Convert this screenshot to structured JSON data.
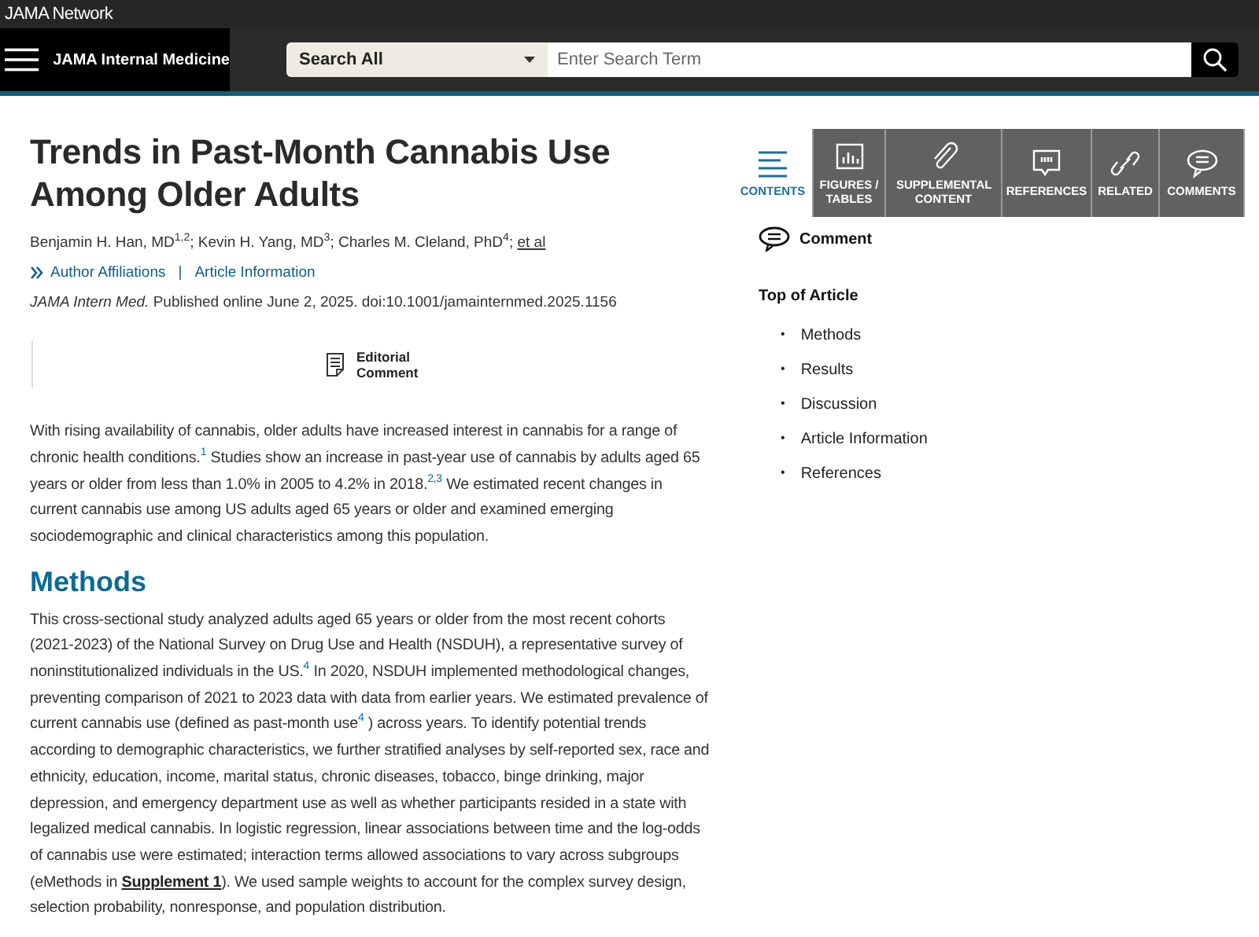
{
  "header": {
    "network": "JAMA Network",
    "journal": "JAMA Internal Medicine",
    "search_scope": "Search All",
    "search_placeholder": "Enter Search Term"
  },
  "article": {
    "title": "Trends in Past-Month Cannabis Use Among Older Adults",
    "authors": [
      {
        "text": "Benjamin H. Han, MD$^{1,2}$; Kevin H. Yang, MD$^{3}$; Charles M. Cleland, PhD$^{4}$; "
      },
      {
        "text": "et al",
        "kind": "link"
      }
    ],
    "info_links": [
      "Author Affiliations",
      "Article Information"
    ],
    "separator": "|",
    "citation": "*JAMA Intern Med.* Published online June 2, 2025. doi:10.1001/jamainternmed.2025.1156",
    "editorial": "Editorial Comment",
    "body": [
      {
        "kind": "paragraph",
        "segments": [
          {
            "text": "With rising availability of cannabis, older adults have increased interest in cannabis for a range of chronic health conditions.$^{1}$ Studies show an increase in past-year use of cannabis by adults aged 65 years or older from less than 1.0% in 2005 to 4.2% in 2018.$^{2,3}$ We estimated recent changes in current cannabis use among US adults aged 65 years or older and examined emerging sociodemographic and clinical characteristics among this population."
          }
        ]
      },
      {
        "kind": "heading",
        "text": "Methods"
      },
      {
        "kind": "paragraph",
        "segments": [
          {
            "text": "This cross-sectional study analyzed adults aged 65 years or older from the most recent cohorts (2021-2023) of the National Survey on Drug Use and Health (NSDUH), a representative survey of noninstitutionalized individuals in the US.$^{4}$ In 2020, NSDUH implemented methodological changes, preventing comparison of 2021 to 2023 data with data from earlier years. We estimated prevalence of current cannabis use (defined as past-month use$^{4}$ ) across years. To identify potential trends according to demographic characteristics, we further stratified analyses by self-reported sex, race and ethnicity, education, income, marital status, chronic diseases, tobacco, binge drinking, major depression, and emergency department use as well as whether participants resided in a state with legalized medical cannabis. In logistic regression, linear associations between time and the log-odds of cannabis use were estimated; interaction terms allowed associations to vary across subgroups (eMethods in "
          },
          {
            "text": "Supplement 1",
            "kind": "link"
          },
          {
            "text": "). We used sample weights to account for the complex survey design, selection probability, nonresponse, and population distribution."
          }
        ]
      }
    ]
  },
  "sidebar": {
    "tabs": [
      {
        "label": "CONTENTS",
        "selected": true
      },
      {
        "label": "FIGURES / TABLES",
        "selected": false
      },
      {
        "label": "SUPPLEMENTAL CONTENT",
        "selected": false
      },
      {
        "label": "REFERENCES",
        "selected": false
      },
      {
        "label": "RELATED",
        "selected": false
      },
      {
        "label": "COMMENTS",
        "selected": false
      }
    ],
    "toc_marker": "•",
    "comment": "Comment",
    "toc_title": "Top of Article",
    "toc": [
      "Methods",
      "Results",
      "Discussion",
      "Article Information",
      "References"
    ]
  }
}
